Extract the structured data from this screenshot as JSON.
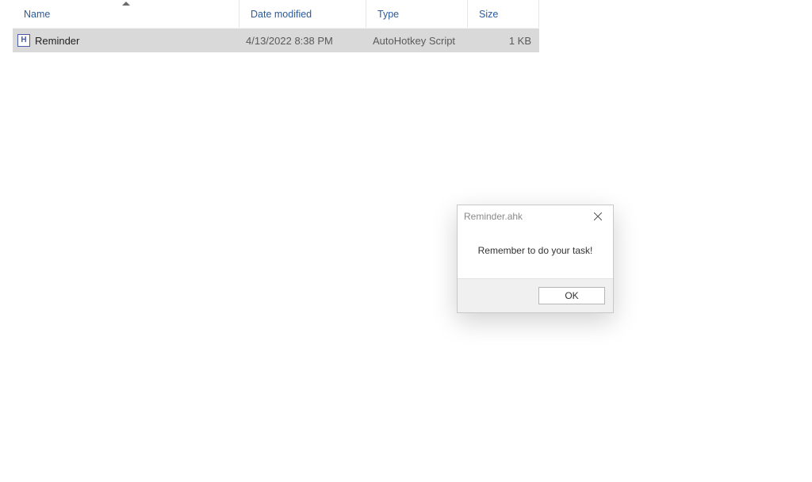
{
  "columns": {
    "name": "Name",
    "date": "Date modified",
    "type": "Type",
    "size": "Size"
  },
  "rows": [
    {
      "icon_letter": "H",
      "name": "Reminder",
      "date": "4/13/2022 8:38 PM",
      "type": "AutoHotkey Script",
      "size": "1 KB"
    }
  ],
  "dialog": {
    "title": "Reminder.ahk",
    "message": "Remember to do your task!",
    "ok": "OK"
  }
}
